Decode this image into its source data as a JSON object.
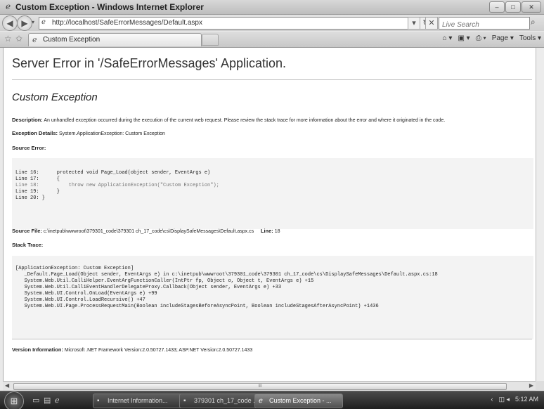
{
  "window": {
    "title": "Custom Exception - Windows Internet Explorer",
    "buttons": [
      "–",
      "□",
      "✕"
    ]
  },
  "address_bar": {
    "url": "http://localhost/SafeErrorMessages/Default.aspx",
    "search_placeholder": "Live Search"
  },
  "tab": {
    "label": "Custom Exception"
  },
  "command_bar": {
    "page": "Page ▾",
    "tools": "Tools ▾"
  },
  "page": {
    "server_error_title": "Server Error in '/SafeErrorMessages' Application.",
    "exception_title": "Custom Exception",
    "description_label": "Description:",
    "description_text": "An unhandled exception occurred during the execution of the current web request. Please review the stack trace for more information about the error and where it originated in the code.",
    "exception_details_label": "Exception Details:",
    "exception_details_text": "System.ApplicationException: Custom Exception",
    "source_error_label": "Source Error:",
    "source_lines": [
      "Line 16:      protected void Page_Load(object sender, EventArgs e)",
      "Line 17:      {",
      "Line 18:          throw new ApplicationException(\"Custom Exception\");",
      "Line 19:      }",
      "Line 20: }"
    ],
    "source_file_label": "Source File:",
    "source_file_text": "c:\\inetpub\\wwwroot\\379301_code\\379301 ch_17_code\\cs\\DisplaySafeMessages\\Default.aspx.cs",
    "line_label": "Line:",
    "line_value": "18",
    "stack_trace_label": "Stack Trace:",
    "stack_lines": [
      "[ApplicationException: Custom Exception]",
      "   _Default.Page_Load(Object sender, EventArgs e) in c:\\inetpub\\wwwroot\\379301_code\\379301 ch_17_code\\cs\\DisplaySafeMessages\\Default.aspx.cs:18",
      "   System.Web.Util.CalliHelper.EventArgFunctionCaller(IntPtr fp, Object o, Object t, EventArgs e) +15",
      "   System.Web.Util.CalliEventHandlerDelegateProxy.Callback(Object sender, EventArgs e) +33",
      "   System.Web.UI.Control.OnLoad(EventArgs e) +99",
      "   System.Web.UI.Control.LoadRecursive() +47",
      "   System.Web.UI.Page.ProcessRequestMain(Boolean includeStagesBeforeAsyncPoint, Boolean includeStagesAfterAsyncPoint) +1436"
    ],
    "version_label": "Version Information:",
    "version_text": "Microsoft .NET Framework Version:2.0.50727.1433; ASP.NET Version:2.0.50727.1433"
  },
  "scrollbar": {
    "thumb_grip": "III"
  },
  "taskbar": {
    "tasks": [
      "Internet Information...",
      "379301 ch_17_code ...",
      "Custom Exception - ..."
    ],
    "clock": "5:12 AM"
  }
}
